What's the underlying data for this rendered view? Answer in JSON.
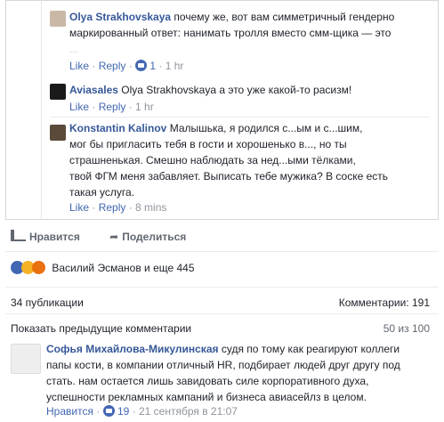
{
  "replies": [
    {
      "author": "Olya Strakhovskaya",
      "text_line1": "почему же, вот вам симметричный гендерно",
      "text_line2": "маркированный ответ: нанимать тролля вместо смм-щика — это",
      "text_line3": "...",
      "actions": {
        "like": "Like",
        "reply": "Reply",
        "likes": "1",
        "time": "1 hr"
      }
    },
    {
      "author": "Aviasales",
      "text": "Olya Strakhovskaya а это уже какой-то расизм!",
      "actions": {
        "like": "Like",
        "reply": "Reply",
        "time": "1 hr"
      }
    },
    {
      "author": "Konstantin Kalinov",
      "line1": "Малышька, я родился с...ым и с...шим,",
      "line2": "мог бы пригласить тебя в гости и хорошенько в..., но ты",
      "line3": "страшненькая. Смешно наблюдать за нед...ыми тёлками,",
      "line4": "твой ФГМ меня забавляет. Выписать тебе мужика? В соске есть",
      "line5": "такая услуга.",
      "actions": {
        "like": "Like",
        "reply": "Reply",
        "time": "8 mins"
      }
    }
  ],
  "post_actions": {
    "like": "Нравится",
    "share": "Поделиться"
  },
  "reactions": {
    "names": "Василий Эсманов и еще 445",
    "colors": [
      "#4267b2",
      "#f7b125",
      "#e9710f"
    ]
  },
  "stats": {
    "shares": "34 публикации",
    "comments": "Комментарии: 191"
  },
  "previous": {
    "label": "Показать предыдущие комментарии",
    "counter": "50 из 100"
  },
  "comment": {
    "author": "Софья Михайлова-Микулинская",
    "line1": "судя по тому как реагируют коллеги",
    "line2": "папы кости, в компании отличный HR, подбирает людей друг другу под",
    "line3": "стать. нам остается лишь завидовать силе корпоративного духа,",
    "line4": "успешности рекламных кампаний и бизнеса авиасейлз в целом.",
    "actions": {
      "like": "Нравится",
      "likes": "19",
      "time": "21 сентября в 21:07"
    }
  }
}
